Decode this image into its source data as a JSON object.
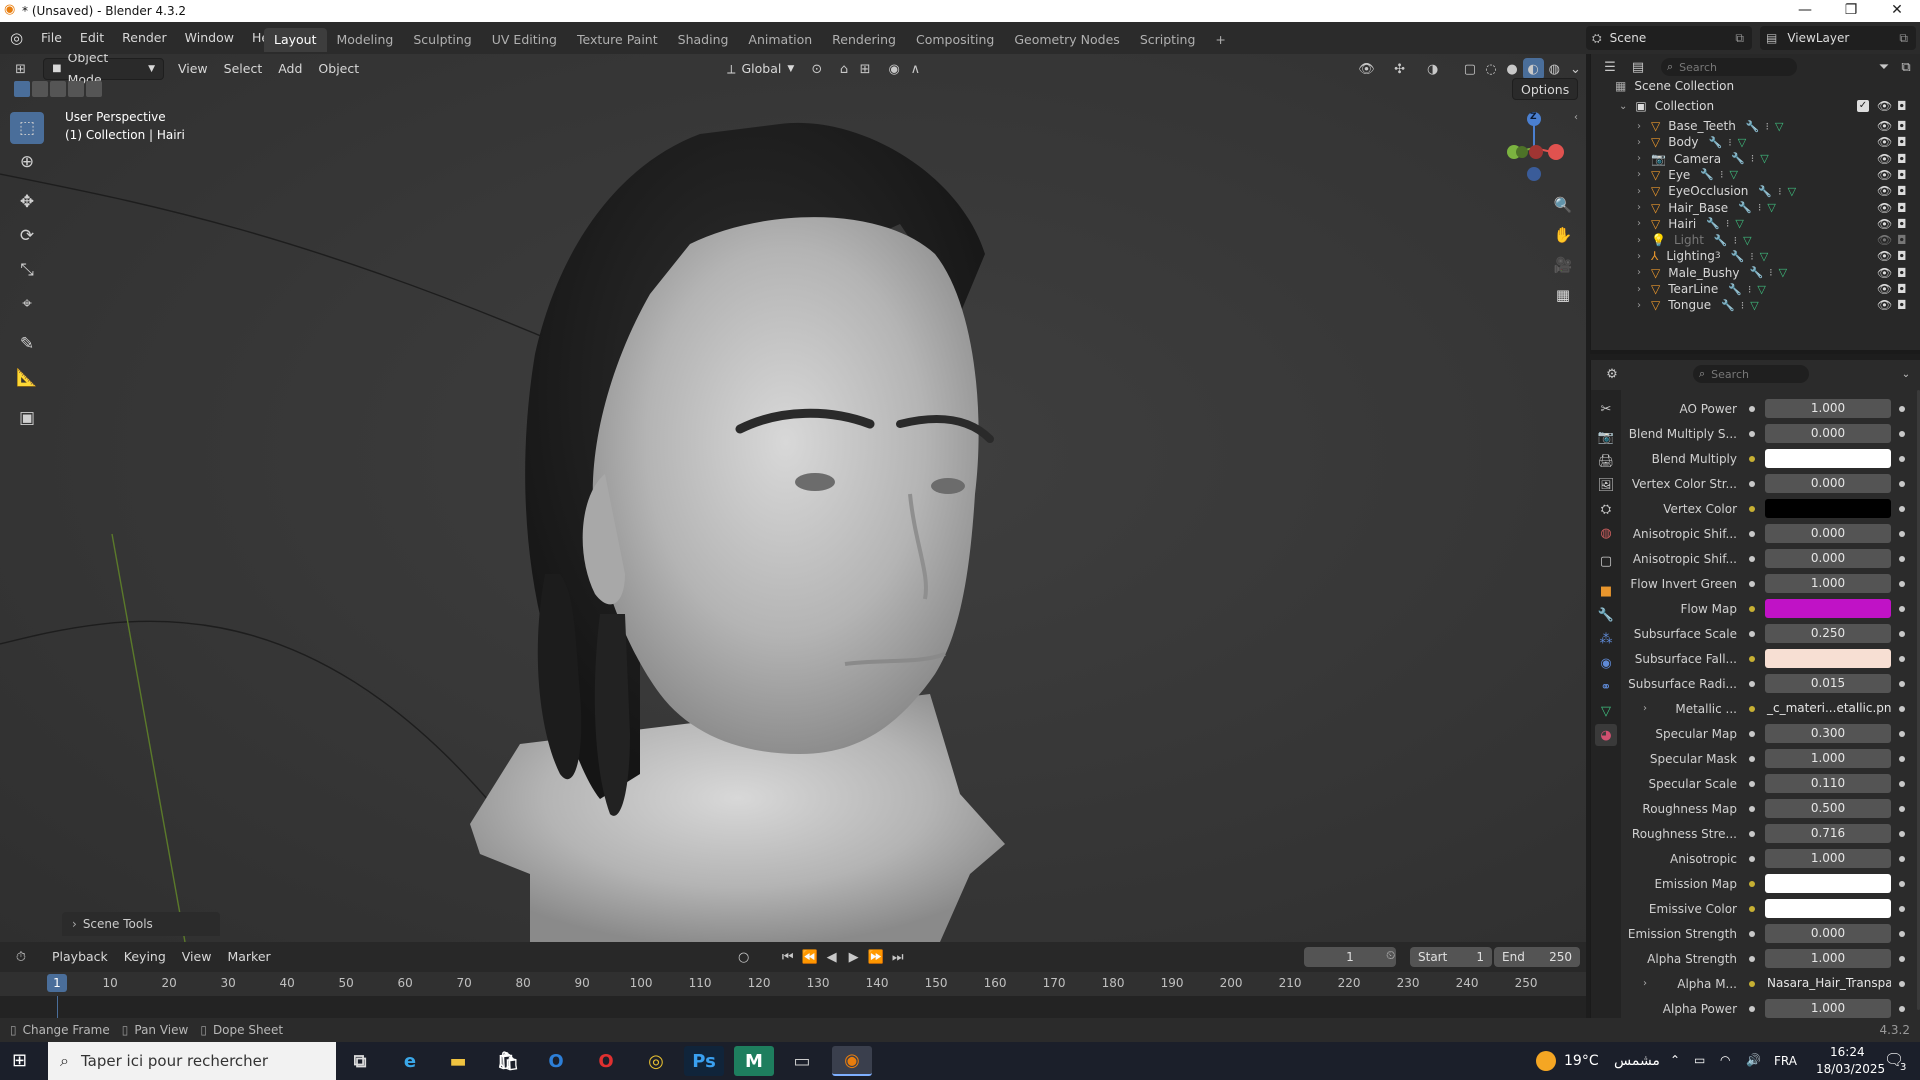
{
  "window": {
    "title": "* (Unsaved) - Blender 4.3.2",
    "minimize": "—",
    "restore": "❐",
    "close": "✕"
  },
  "topbar": {
    "menus": [
      "File",
      "Edit",
      "Render",
      "Window",
      "Help"
    ],
    "workspaces": [
      "Layout",
      "Modeling",
      "Sculpting",
      "UV Editing",
      "Texture Paint",
      "Shading",
      "Animation",
      "Rendering",
      "Compositing",
      "Geometry Nodes",
      "Scripting"
    ],
    "active_workspace": "Layout",
    "add_tab": "+",
    "scene": "Scene",
    "view_layer": "ViewLayer"
  },
  "viewport": {
    "mode": "Object Mode",
    "menus": [
      "View",
      "Select",
      "Add",
      "Object"
    ],
    "orientation": "Global",
    "options": "Options",
    "overlay_line1": "User Perspective",
    "overlay_line2": "(1) Collection | Hairi",
    "gizmo_z": "Z",
    "scene_tools": "Scene Tools"
  },
  "timeline": {
    "menus": [
      "Playback",
      "Keying",
      "View",
      "Marker"
    ],
    "current_frame": "1",
    "start_label": "Start",
    "start_value": "1",
    "end_label": "End",
    "end_value": "250",
    "ticks": [
      "10",
      "20",
      "30",
      "40",
      "50",
      "60",
      "70",
      "80",
      "90",
      "100",
      "110",
      "120",
      "130",
      "140",
      "150",
      "160",
      "170",
      "180",
      "190",
      "200",
      "210",
      "220",
      "230",
      "240",
      "250"
    ],
    "playhead_label": "1"
  },
  "statusbar": {
    "change_frame": "Change Frame",
    "pan_view": "Pan View",
    "dope_sheet": "Dope Sheet",
    "version": "4.3.2"
  },
  "outliner": {
    "search_placeholder": "Search",
    "scene_collection": "Scene Collection",
    "collection": "Collection",
    "items": [
      {
        "name": "Base_Teeth",
        "kind": "mesh"
      },
      {
        "name": "Body",
        "kind": "mesh"
      },
      {
        "name": "Camera",
        "kind": "camera"
      },
      {
        "name": "Eye",
        "kind": "mesh"
      },
      {
        "name": "EyeOcclusion",
        "kind": "mesh"
      },
      {
        "name": "Hair_Base",
        "kind": "mesh"
      },
      {
        "name": "Hairi",
        "kind": "mesh"
      },
      {
        "name": "Light",
        "kind": "light"
      },
      {
        "name": "Lighting",
        "kind": "lightgroup",
        "badge": "3"
      },
      {
        "name": "Male_Bushy",
        "kind": "mesh"
      },
      {
        "name": "TearLine",
        "kind": "mesh"
      },
      {
        "name": "Tongue",
        "kind": "mesh"
      }
    ]
  },
  "properties": {
    "search_placeholder": "Search",
    "rows": [
      {
        "label": "AO Power",
        "value": "1.000",
        "type": "num"
      },
      {
        "label": "Blend Multiply S...",
        "value": "0.000",
        "type": "num"
      },
      {
        "label": "Blend Multiply",
        "value": "",
        "type": "color",
        "color": "#ffffff"
      },
      {
        "label": "Vertex Color Str...",
        "value": "0.000",
        "type": "num"
      },
      {
        "label": "Vertex Color",
        "value": "",
        "type": "color",
        "color": "#000000"
      },
      {
        "label": "Anisotropic Shif...",
        "value": "0.000",
        "type": "num"
      },
      {
        "label": "Anisotropic Shif...",
        "value": "0.000",
        "type": "num"
      },
      {
        "label": "Flow Invert Green",
        "value": "1.000",
        "type": "num"
      },
      {
        "label": "Flow Map",
        "value": "",
        "type": "color",
        "color": "#c012c6"
      },
      {
        "label": "Subsurface Scale",
        "value": "0.250",
        "type": "num"
      },
      {
        "label": "Subsurface Fall...",
        "value": "",
        "type": "color",
        "color": "#f7dfd3"
      },
      {
        "label": "Subsurface Radi...",
        "value": "0.015",
        "type": "num"
      },
      {
        "label": "Metallic ...",
        "value": "_c_materi...etallic.png",
        "type": "tex"
      },
      {
        "label": "Specular Map",
        "value": "0.300",
        "type": "num"
      },
      {
        "label": "Specular Mask",
        "value": "1.000",
        "type": "num"
      },
      {
        "label": "Specular Scale",
        "value": "0.110",
        "type": "num"
      },
      {
        "label": "Roughness Map",
        "value": "0.500",
        "type": "num"
      },
      {
        "label": "Roughness Stre...",
        "value": "0.716",
        "type": "num"
      },
      {
        "label": "Anisotropic",
        "value": "1.000",
        "type": "num"
      },
      {
        "label": "Emission Map",
        "value": "",
        "type": "color",
        "color": "#ffffff"
      },
      {
        "label": "Emissive Color",
        "value": "",
        "type": "color",
        "color": "#ffffff"
      },
      {
        "label": "Emission Strength",
        "value": "0.000",
        "type": "num"
      },
      {
        "label": "Alpha Strength",
        "value": "1.000",
        "type": "num"
      },
      {
        "label": "Alpha M...",
        "value": "Nasara_Hair_Transpar...",
        "type": "tex"
      },
      {
        "label": "Alpha Power",
        "value": "1.000",
        "type": "num"
      }
    ]
  },
  "taskbar": {
    "search_placeholder": "Taper ici pour rechercher",
    "weather_temp": "19°C",
    "weather_desc": "مشمس",
    "language": "FRA",
    "time": "16:24",
    "date": "18/03/2025",
    "notif_count": "3"
  }
}
